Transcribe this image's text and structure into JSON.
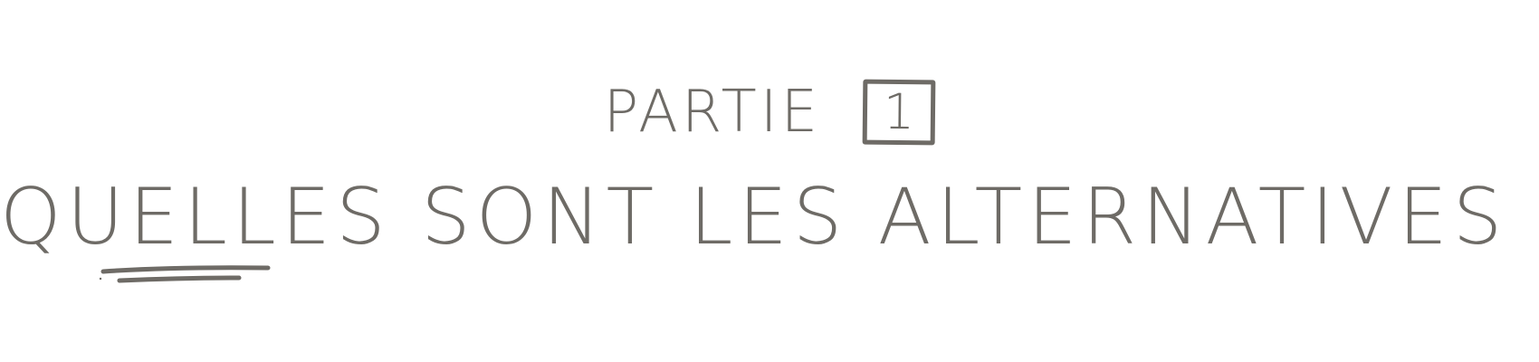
{
  "header": {
    "part_word": "PARTIE",
    "part_number": "1"
  },
  "main": {
    "title": "QUELLES SONT LES ALTERNATIVES ?"
  },
  "colors": {
    "ink": "#6e6b66",
    "background": "#ffffff"
  }
}
